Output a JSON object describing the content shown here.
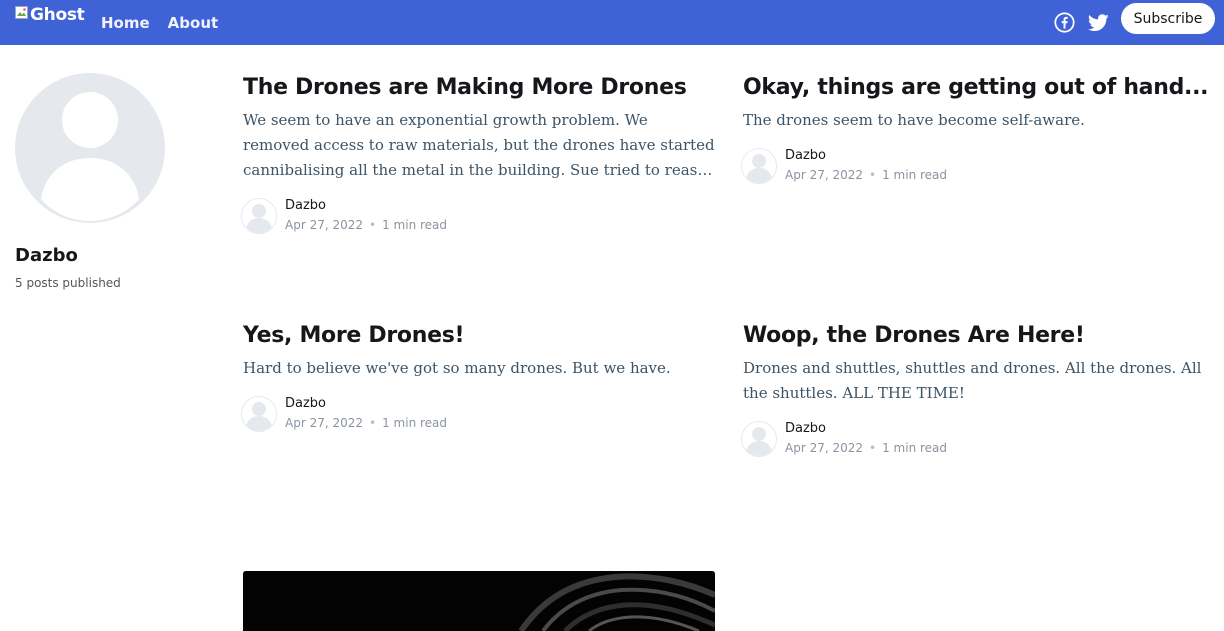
{
  "header": {
    "logo_alt": "Ghost",
    "nav": [
      {
        "label": "Home"
      },
      {
        "label": "About"
      }
    ],
    "social": [
      {
        "icon": "facebook-icon"
      },
      {
        "icon": "twitter-icon"
      }
    ],
    "subscribe_label": "Subscribe",
    "bg_color": "#3f62d7"
  },
  "author": {
    "name": "Dazbo",
    "posts_published": "5 posts published"
  },
  "posts": [
    {
      "title": "The Drones are Making More Drones",
      "excerpt": "We seem to have an exponential growth problem.  We removed access to raw materials, but the drones have started cannibalising all the metal in the building.  Sue tried to reason with one.  Poor...",
      "author": "Dazbo",
      "date": "Apr 27, 2022",
      "read_time": "1 min read"
    },
    {
      "title": "Okay, things are getting out of hand...",
      "excerpt": "The drones seem to have become self-aware.",
      "author": "Dazbo",
      "date": "Apr 27, 2022",
      "read_time": "1 min read"
    },
    {
      "title": "Yes, More Drones!",
      "excerpt": "Hard to believe we've got so many drones.  But we have.",
      "author": "Dazbo",
      "date": "Apr 27, 2022",
      "read_time": "1 min read"
    },
    {
      "title": "Woop, the Drones Are Here!",
      "excerpt": "Drones and shuttles, shuttles and drones.  All the drones.  All the shuttles. ALL THE TIME!",
      "author": "Dazbo",
      "date": "Apr 27, 2022",
      "read_time": "1 min read"
    }
  ]
}
